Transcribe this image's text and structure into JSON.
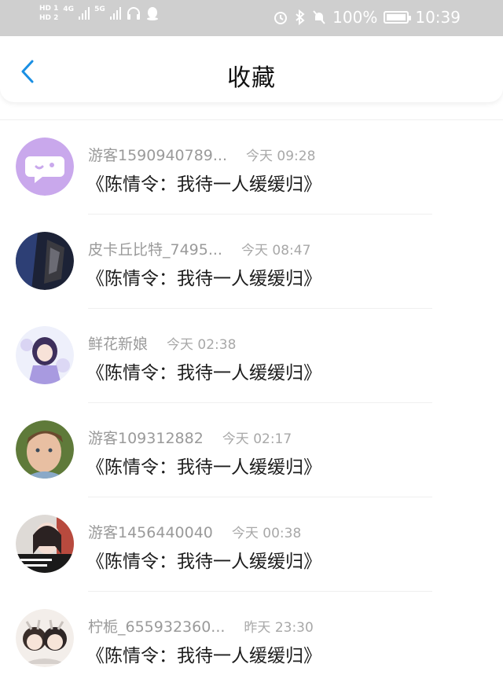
{
  "status_bar": {
    "hd1": "HD 1",
    "hd2": "HD 2",
    "net1": "4G",
    "net2": "5G",
    "battery": "100%",
    "time": "10:39"
  },
  "header": {
    "title": "收藏",
    "back_icon": "chevron-left-icon",
    "accent": "#1a8fe3"
  },
  "items": [
    {
      "name": "游客1590940789...",
      "time": "今天 09:28",
      "title": "《陈情令：我待一人缓缓归》",
      "avatar": "chat-bubble-avatar"
    },
    {
      "name": "皮卡丘比特_7495...",
      "time": "今天 08:47",
      "title": "《陈情令：我待一人缓缓归》",
      "avatar": "dark-photo-avatar"
    },
    {
      "name": "鲜花新娘",
      "time": "今天 02:38",
      "title": "《陈情令：我待一人缓缓归》",
      "avatar": "anime-girl-avatar"
    },
    {
      "name": "游客109312882",
      "time": "今天 02:17",
      "title": "《陈情令：我待一人缓缓归》",
      "avatar": "boy-photo-avatar"
    },
    {
      "name": "游客1456440040",
      "time": "今天 00:38",
      "title": "《陈情令：我待一人缓缓归》",
      "avatar": "girl-photo-avatar"
    },
    {
      "name": "柠栀_655932360...",
      "time": "昨天 23:30",
      "title": "《陈情令：我待一人缓缓归》",
      "avatar": "chibi-pair-avatar"
    }
  ]
}
